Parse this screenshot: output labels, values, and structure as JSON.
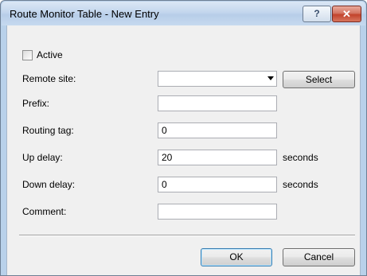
{
  "window": {
    "title": "Route Monitor Table - New Entry",
    "help_label": "?",
    "close_label": "✕"
  },
  "form": {
    "active": {
      "label": "Active",
      "checked": false
    },
    "remote_site": {
      "label": "Remote site:",
      "value": "",
      "select_label": "Select"
    },
    "prefix": {
      "label": "Prefix:",
      "value": ""
    },
    "routing_tag": {
      "label": "Routing tag:",
      "value": "0"
    },
    "up_delay": {
      "label": "Up delay:",
      "value": "20",
      "unit": "seconds"
    },
    "down_delay": {
      "label": "Down delay:",
      "value": "0",
      "unit": "seconds"
    },
    "comment": {
      "label": "Comment:",
      "value": ""
    }
  },
  "buttons": {
    "ok_label": "OK",
    "cancel_label": "Cancel"
  }
}
